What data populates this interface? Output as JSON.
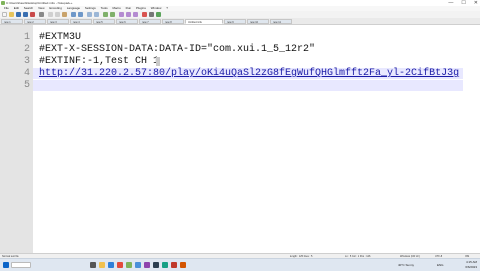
{
  "window": {
    "title": "C:\\Users\\Kaan\\Desktop\\Untitled.m3u - Notepad++",
    "controls": [
      "—",
      "☐",
      "✕"
    ]
  },
  "menubar": {
    "items": [
      "File",
      "Edit",
      "Search",
      "View",
      "Encoding",
      "Language",
      "Settings",
      "Tools",
      "Macro",
      "Run",
      "Plugins",
      "Window",
      "?"
    ]
  },
  "tabs": [
    {
      "label": "new 1"
    },
    {
      "label": "new 2"
    },
    {
      "label": "new 3"
    },
    {
      "label": "new 4"
    },
    {
      "label": "new 5"
    },
    {
      "label": "new 6"
    },
    {
      "label": "new 7"
    },
    {
      "label": "new 8"
    },
    {
      "label": "Untitled.m3u"
    },
    {
      "label": "new 9"
    },
    {
      "label": "new 10"
    },
    {
      "label": "new 11"
    }
  ],
  "editor": {
    "lines": [
      {
        "num": "1",
        "text": "#EXTM3U"
      },
      {
        "num": "2",
        "text": "#EXT-X-SESSION-DATA:DATA-ID=\"com.xui.1_5_12r2\""
      },
      {
        "num": "3",
        "text": "#EXTINF:-1,Test CH 1"
      },
      {
        "num": "4",
        "text": "http://31.220.2.57:80/play/oKi4uQaSl2zG8fEgWufQHGlmfft2Fa_yl-2CifBtJ3g"
      },
      {
        "num": "5",
        "text": ""
      }
    ]
  },
  "statusbar": {
    "left": "Normal text file",
    "length": "length : 125    lines : 5",
    "position": "Ln : 5    Col : 1    Pos : 126",
    "eol": "Windows (CR LF)",
    "encoding": "UTF-8",
    "mode": "INS"
  },
  "taskbar": {
    "weather": "40°C  Sunny",
    "lang": "ENG",
    "time": "4:15 AM",
    "date": "6/6/2023",
    "colors": {
      "accent": "#0a64c8"
    }
  }
}
